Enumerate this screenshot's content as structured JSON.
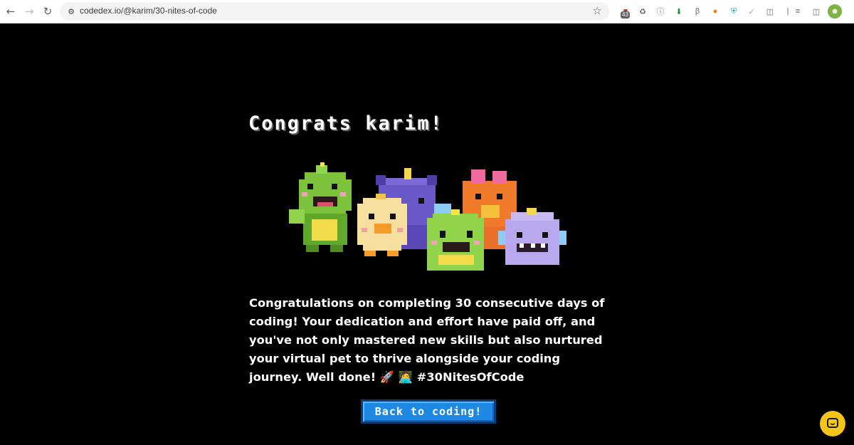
{
  "browser": {
    "url": "codedex.io/@karim/30-nites-of-code",
    "back_icon": "arrow-left-icon",
    "forward_icon": "arrow-right-icon",
    "reload_icon": "reload-icon",
    "extension_badge_count": "43"
  },
  "page": {
    "heading": "Congrats karim!",
    "message": "Congratulations on completing 30 consecutive days of coding! Your dedication and effort have paid off, and you've not only mastered new skills but also nurtured your virtual pet to thrive alongside your coding journey. Well done! 🚀 🧑‍💻 #30NitesOfCode",
    "cta_label": "Back to coding!",
    "chat_icon": "chat-bubble-icon"
  },
  "colors": {
    "background": "#000000",
    "button": "#1e88e5",
    "chat_launcher": "#f5c518"
  }
}
